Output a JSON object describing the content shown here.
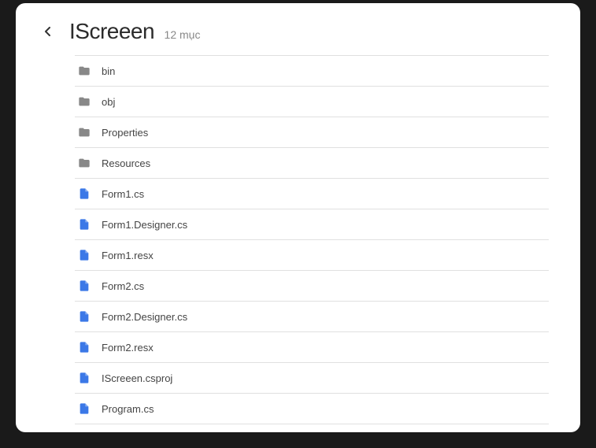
{
  "header": {
    "title": "IScreeen",
    "subtitle": "12 mục"
  },
  "items": [
    {
      "type": "folder",
      "name": "bin"
    },
    {
      "type": "folder",
      "name": "obj"
    },
    {
      "type": "folder",
      "name": "Properties"
    },
    {
      "type": "folder",
      "name": "Resources"
    },
    {
      "type": "file",
      "name": "Form1.cs"
    },
    {
      "type": "file",
      "name": "Form1.Designer.cs"
    },
    {
      "type": "file",
      "name": "Form1.resx"
    },
    {
      "type": "file",
      "name": "Form2.cs"
    },
    {
      "type": "file",
      "name": "Form2.Designer.cs"
    },
    {
      "type": "file",
      "name": "Form2.resx"
    },
    {
      "type": "file",
      "name": "IScreeen.csproj"
    },
    {
      "type": "file",
      "name": "Program.cs"
    }
  ]
}
